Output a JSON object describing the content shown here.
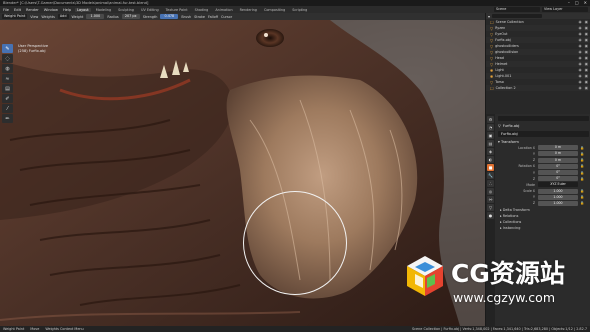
{
  "window": {
    "title": "Blender* [C:\\Users\\T-Gamer\\Documents\\3D Models\\animal\\animal-fur-test.blend]",
    "controls": [
      "–",
      "□",
      "✕"
    ]
  },
  "menubar": {
    "items": [
      "File",
      "Edit",
      "Render",
      "Window",
      "Help"
    ],
    "workspaces": [
      "Layout",
      "Modeling",
      "Sculpting",
      "UV Editing",
      "Texture Paint",
      "Shading",
      "Animation",
      "Rendering",
      "Compositing",
      "Scripting"
    ],
    "active_workspace": "Layout",
    "scene_label": "Scene",
    "view_layer_label": "View Layer"
  },
  "tool_header": {
    "mode": "Weight Paint",
    "view": "View",
    "weights": "Weights",
    "brush": "Add",
    "weight_label": "Weight",
    "weight_value": "1.000",
    "radius_label": "Radius",
    "radius_value": "207 px",
    "strength_label": "Strength",
    "strength_value": "0.478",
    "brush_menu": "Brush",
    "stroke_menu": "Stroke",
    "falloff_menu": "Falloff",
    "cursor_menu": "Cursor"
  },
  "viewport": {
    "info_line1": "User Perspective",
    "info_line2": "(258) Furfix.obj"
  },
  "toolbar": {
    "tools": [
      {
        "icon": "draw-icon",
        "glyph": "✎"
      },
      {
        "icon": "blur-icon",
        "glyph": "◌"
      },
      {
        "icon": "average-icon",
        "glyph": "◍"
      },
      {
        "icon": "smear-icon",
        "glyph": "≈"
      },
      {
        "icon": "gradient-icon",
        "glyph": "▤"
      },
      {
        "icon": "sample-weight-icon",
        "glyph": "✐"
      },
      {
        "icon": "sample-group-icon",
        "glyph": "⁄"
      },
      {
        "icon": "annotate-icon",
        "glyph": "✏"
      }
    ]
  },
  "outliner": {
    "rows": [
      {
        "name": "Scene Collection",
        "icon": "☐"
      },
      {
        "name": "Ryzen",
        "icon": "▽"
      },
      {
        "name": "EyeOut",
        "icon": "▽"
      },
      {
        "name": "Furfix.obj",
        "icon": "▽"
      },
      {
        "name": "ghostcolliders",
        "icon": "▽"
      },
      {
        "name": "ghostcollision",
        "icon": "▽"
      },
      {
        "name": "Head",
        "icon": "▽"
      },
      {
        "name": "Helmet",
        "icon": "▽"
      },
      {
        "name": "Light",
        "icon": "✺"
      },
      {
        "name": "Light.001",
        "icon": "✺"
      },
      {
        "name": "Torso",
        "icon": "▽"
      },
      {
        "name": "Collection 2",
        "icon": "☐"
      }
    ]
  },
  "properties": {
    "object_header": "Furfix.obj",
    "name_field": "Furfix.obj",
    "transform_section": "Transform",
    "fields": [
      {
        "label": "Location X",
        "value": "0 m"
      },
      {
        "label": "Y",
        "value": "0 m"
      },
      {
        "label": "Z",
        "value": "0 m"
      },
      {
        "label": "Rotation X",
        "value": "0°"
      },
      {
        "label": "Y",
        "value": "0°"
      },
      {
        "label": "Z",
        "value": "0°"
      },
      {
        "label": "Mode",
        "value": "XYZ Euler"
      },
      {
        "label": "Scale X",
        "value": "1.000"
      },
      {
        "label": "Y",
        "value": "1.000"
      },
      {
        "label": "Z",
        "value": "1.000"
      }
    ],
    "subsections": [
      "Delta Transform",
      "Relations",
      "Collections",
      "Instancing"
    ]
  },
  "statusbar": {
    "left1": "Weight Paint",
    "left2": "Move",
    "left3": "Weights Context Menu",
    "stats": "Scene Collection | Furfix.obj | Verts:1,348,002 | Faces:1,341,640 | Tris:2,683,280 | Objects:1/12 | 2.82.7"
  },
  "watermark": {
    "brand": "CG资源站",
    "url": "www.cgzyw.com"
  },
  "colors": {
    "accent_blue": "#4772b3",
    "active_prop_tab": "#e07030",
    "watermark_text": "#ffffff"
  }
}
